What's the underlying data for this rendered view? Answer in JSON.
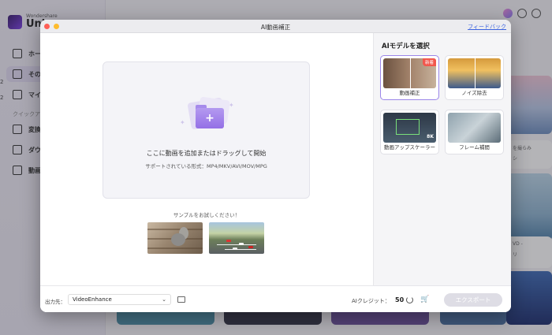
{
  "background_app": {
    "logo_small": "Wondershare",
    "logo_big": "Uni",
    "nav_items": [
      {
        "label": "ホー",
        "icon": "home-icon"
      },
      {
        "label": "その",
        "icon": "toolbox-icon"
      },
      {
        "label": "マイ",
        "icon": "folder-icon"
      },
      {
        "label": "変換",
        "icon": "convert-icon"
      },
      {
        "label": "ダウ",
        "icon": "download-icon"
      },
      {
        "label": "動画",
        "icon": "video-icon"
      }
    ],
    "quick_label": "クイックア",
    "side_texts": [
      "を撮らみ",
      "シ",
      "VD -",
      "リ"
    ],
    "left_chars": [
      "2",
      "2"
    ]
  },
  "modal": {
    "title": "AI動画補正",
    "feedback_link": "フィードバック",
    "dropzone": {
      "main_text": "ここに動画を追加またはドラッグして開始",
      "sub_text": "サポートされている形式：MP4/MKV/AVI/MOV/MPG"
    },
    "samples_label": "サンプルをお試しください！",
    "samples": [
      {
        "name": "squirrel-sample"
      },
      {
        "name": "highway-sample"
      }
    ],
    "right_pane": {
      "title": "AIモデルを選択",
      "models": [
        {
          "label": "動画補正",
          "badge": "新着",
          "selected": true
        },
        {
          "label": "ノイズ除去",
          "badge": "",
          "selected": false
        },
        {
          "label": "動画アップスケーラー",
          "badge": "",
          "overlay": "8K",
          "selected": false
        },
        {
          "label": "フレーム補間",
          "badge": "",
          "selected": false
        }
      ]
    },
    "footer": {
      "output_label": "出力先：",
      "output_value": "VideoEnhance",
      "credit_label": "AIクレジット：",
      "credit_value": "50",
      "export_button": "エクスポート"
    }
  },
  "colors": {
    "accent": "#9b86e9",
    "link": "#3b63e0",
    "badge": "#f2574d",
    "export_disabled": "#dedde5"
  }
}
